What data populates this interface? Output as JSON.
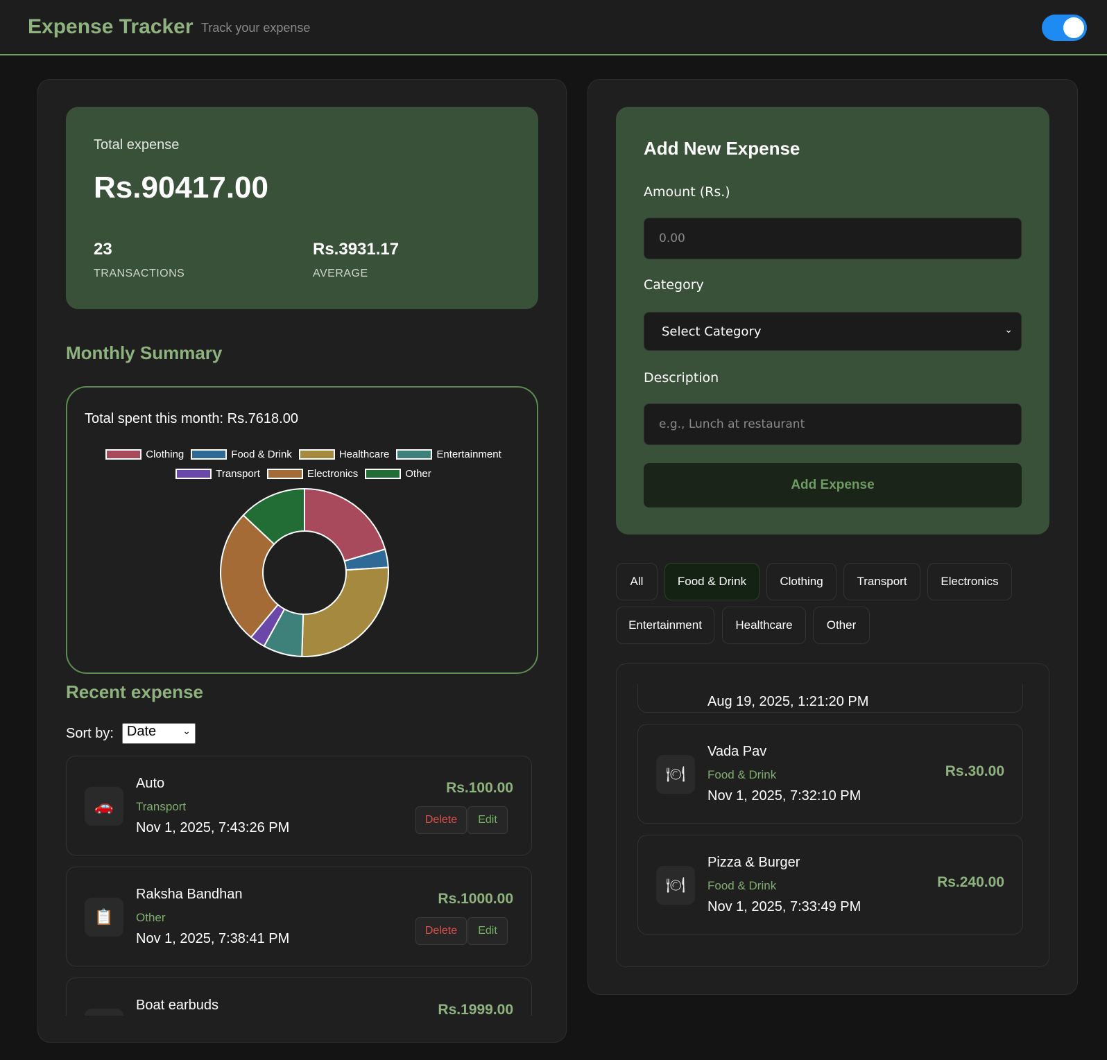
{
  "header": {
    "title": "Expense Tracker",
    "subtitle": "Track your expense",
    "theme_toggle_on": true
  },
  "summary": {
    "total_label": "Total expense",
    "total_value": "Rs.90417.00",
    "transactions_count": "23",
    "transactions_label": "TRANSACTIONS",
    "average_value": "Rs.3931.17",
    "average_label": "AVERAGE"
  },
  "monthly": {
    "heading": "Monthly Summary",
    "total_text": "Total spent this month: Rs.7618.00"
  },
  "chart_data": {
    "type": "pie",
    "donut": true,
    "categories": [
      "Clothing",
      "Food & Drink",
      "Healthcare",
      "Entertainment",
      "Transport",
      "Electronics",
      "Other"
    ],
    "values": [
      20.5,
      3.5,
      26.5,
      7.5,
      3.0,
      26.0,
      13.0
    ],
    "colors": [
      "#a84a5c",
      "#2f6a97",
      "#a4893f",
      "#3d817a",
      "#6a47a8",
      "#a56b36",
      "#226c36"
    ],
    "legend": "top"
  },
  "recent": {
    "heading": "Recent expense",
    "sort_label": "Sort by:",
    "sort_value": "Date",
    "items": [
      {
        "icon": "car-icon",
        "glyph": "🚗",
        "name": "Auto",
        "category": "Transport",
        "date": "Nov 1, 2025, 7:43:26 PM",
        "amount": "Rs.100.00",
        "delete": "Delete",
        "edit": "Edit"
      },
      {
        "icon": "clipboard-icon",
        "glyph": "📋",
        "name": "Raksha Bandhan",
        "category": "Other",
        "date": "Nov 1, 2025, 7:38:41 PM",
        "amount": "Rs.1000.00",
        "delete": "Delete",
        "edit": "Edit"
      },
      {
        "icon": "headphones-icon",
        "glyph": "🎧",
        "name": "Boat earbuds",
        "category": "",
        "date": "",
        "amount": "Rs.1999.00"
      }
    ]
  },
  "form": {
    "title": "Add New Expense",
    "amount_label": "Amount (Rs.)",
    "amount_placeholder": "0.00",
    "category_label": "Category",
    "category_value": "Select Category",
    "description_label": "Description",
    "description_placeholder": "e.g., Lunch at restaurant",
    "submit_label": "Add Expense"
  },
  "filters": {
    "chips": [
      "All",
      "Food & Drink",
      "Clothing",
      "Transport",
      "Electronics",
      "Entertainment",
      "Healthcare",
      "Other"
    ],
    "active": "Food & Drink"
  },
  "filtered": {
    "partial_date": "Aug 19, 2025, 1:21:20 PM",
    "items": [
      {
        "icon": "plate-icon",
        "glyph": "🍽",
        "name": "Vada Pav",
        "category": "Food & Drink",
        "date": "Nov 1, 2025, 7:32:10 PM",
        "amount": "Rs.30.00"
      },
      {
        "icon": "plate-icon",
        "glyph": "🍽",
        "name": "Pizza & Burger",
        "category": "Food & Drink",
        "date": "Nov 1, 2025, 7:33:49 PM",
        "amount": "Rs.240.00"
      }
    ]
  }
}
